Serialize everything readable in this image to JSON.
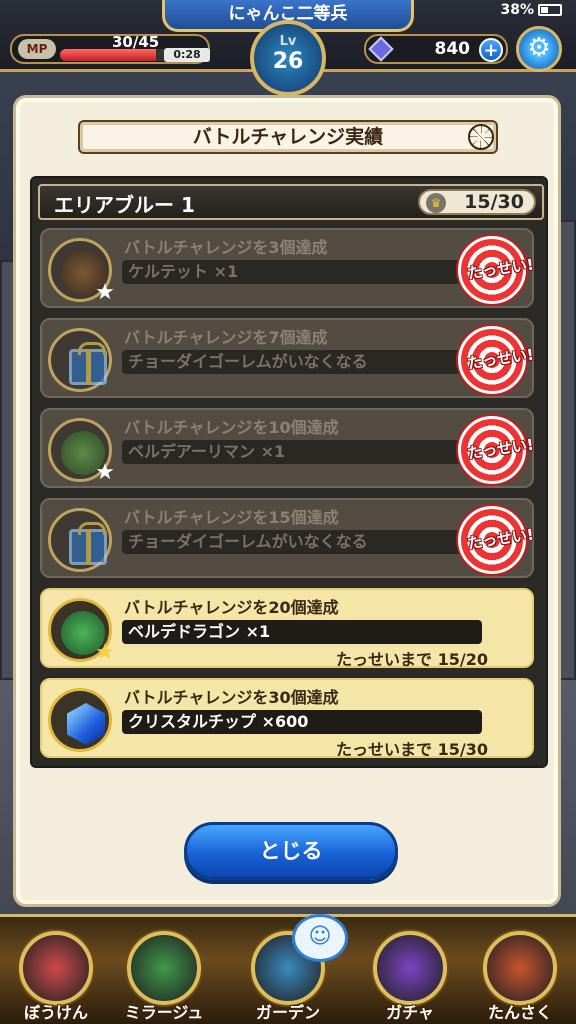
{
  "header": {
    "rank_title": "にゃんこ二等兵",
    "battery": "38%",
    "mp_label": "MP",
    "mp_value": "30/45",
    "mp_fraction": 0.667,
    "mp_timer": "0:28",
    "level_label": "Lv",
    "level_value": "26",
    "gem_count": "840",
    "plus_label": "+"
  },
  "dialog": {
    "title": "バトルチャレンジ実績",
    "area_title": "エリアブルー 1",
    "area_progress": "15/30",
    "rows": [
      {
        "desc": "バトルチャレンジを3個達成",
        "reward": "ケルテット ×1",
        "status": "done",
        "stamp": "たっせい!"
      },
      {
        "desc": "バトルチャレンジを7個達成",
        "reward": "チョーダイゴーレムがいなくなる",
        "status": "done",
        "stamp": "たっせい!"
      },
      {
        "desc": "バトルチャレンジを10個達成",
        "reward": "ベルデアーリマン ×1",
        "status": "done",
        "stamp": "たっせい!"
      },
      {
        "desc": "バトルチャレンジを15個達成",
        "reward": "チョーダイゴーレムがいなくなる",
        "status": "done",
        "stamp": "たっせい!"
      },
      {
        "desc": "バトルチャレンジを20個達成",
        "reward": "ベルデドラゴン ×1",
        "status": "active",
        "progress": "たっせいまで 15/20"
      },
      {
        "desc": "バトルチャレンジを30個達成",
        "reward": "クリスタルチップ ×600",
        "status": "active",
        "progress": "たっせいまで 15/30"
      }
    ],
    "close_label": "とじる"
  },
  "bottom_nav": [
    {
      "label": "ぼうけん",
      "color": "#d04a4a",
      "icon": "chest-icon"
    },
    {
      "label": "ミラージュ",
      "color": "#3f9a4a",
      "icon": "ghost-icon"
    },
    {
      "label": "ガーデン",
      "color": "#3a8bbf",
      "icon": "house-icon"
    },
    {
      "label": "ガチャ",
      "color": "#7b44c4",
      "icon": "crystal-icon"
    },
    {
      "label": "たんさく",
      "color": "#c9552e",
      "icon": "mountain-icon"
    }
  ],
  "colors": {
    "accent_gold": "#d9b663",
    "button_blue": "#1a62d6",
    "stamp_red": "#e33333"
  }
}
